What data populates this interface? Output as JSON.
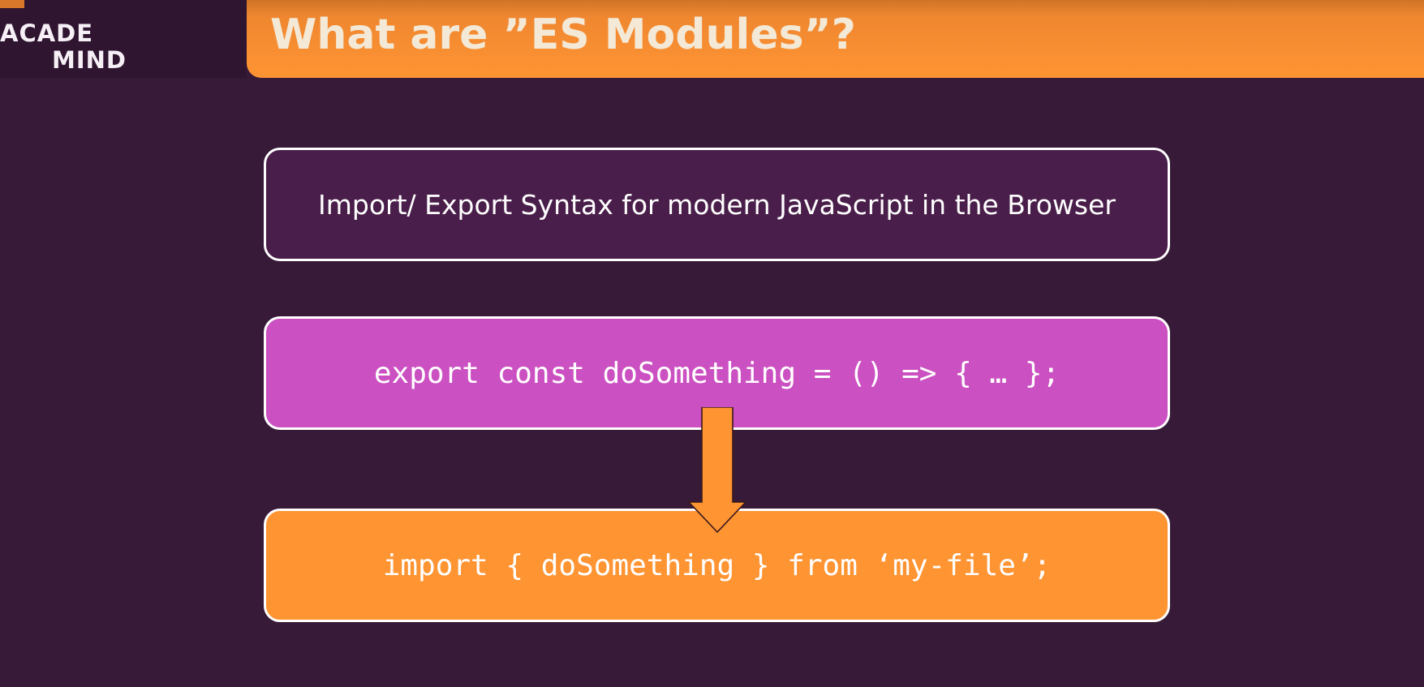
{
  "logo": {
    "line1": "ACADE",
    "line2": "MIND"
  },
  "header": {
    "title": "What are ”ES Modules”?"
  },
  "flow": {
    "description": "Import/ Export Syntax for modern JavaScript in the Browser",
    "export_code": "export const doSomething = () => { … };",
    "import_code": "import { doSomething } from ‘my-file’;"
  },
  "colors": {
    "background": "#371938",
    "header_orange": "#ff9433",
    "description_box": "#4a1e4a",
    "export_box": "#cb50c1",
    "import_box": "#ff9433",
    "arrow": "#ff9433"
  }
}
